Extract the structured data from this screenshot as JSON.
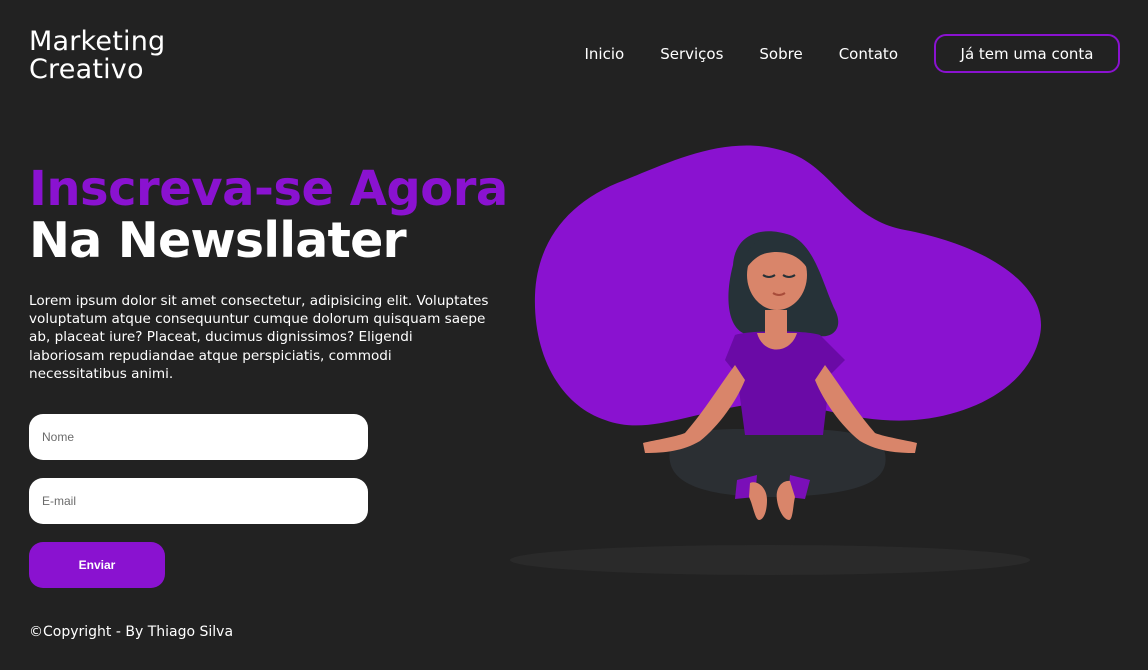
{
  "brand": {
    "line1": "Marketing",
    "line2": "Creativo"
  },
  "nav": {
    "items": [
      {
        "label": "Inicio"
      },
      {
        "label": "Serviços"
      },
      {
        "label": "Sobre"
      },
      {
        "label": "Contato"
      }
    ],
    "cta_label": "Já tem uma conta"
  },
  "hero": {
    "title_highlight": "Inscreva-se Agora",
    "title_main": "Na Newsllater",
    "description": "Lorem ipsum dolor sit amet consectetur, adipisicing elit. Voluptates voluptatum atque consequuntur cumque dolorum quisquam saepe ab, placeat iure? Placeat, ducimus dignissimos? Eligendi laboriosam repudiandae atque perspiciatis, commodi necessitatibus animi."
  },
  "form": {
    "name_placeholder": "Nome",
    "name_value": "",
    "email_placeholder": "E-mail",
    "email_value": "",
    "submit_label": "Enviar"
  },
  "footer": {
    "text": "©Copyright - By Thiago Silva"
  },
  "illustration": {
    "name": "meditating-woman-illustration"
  },
  "colors": {
    "background": "#222222",
    "accent": "#8a12d0",
    "text": "#ffffff",
    "input_bg": "#ffffff"
  }
}
